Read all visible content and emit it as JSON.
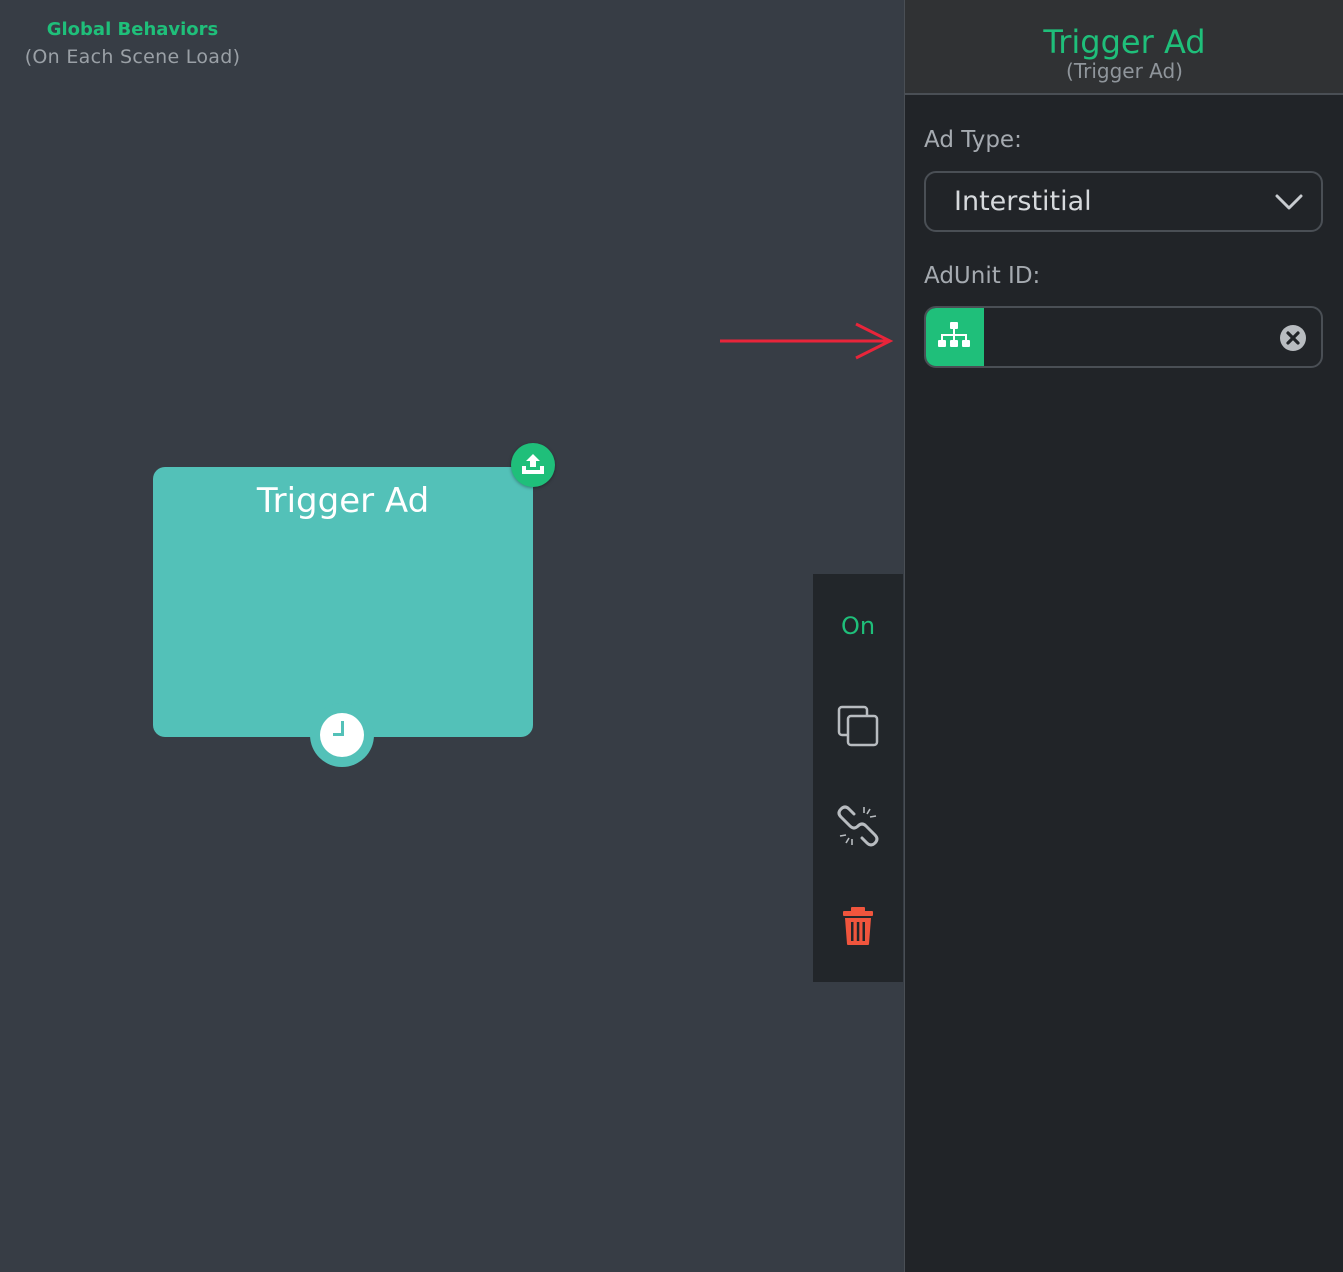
{
  "canvas": {
    "scene_title": "Global Behaviors",
    "scene_subtitle": "(On Each Scene Load)"
  },
  "node": {
    "title": "Trigger Ad",
    "color": "#53c1b8",
    "export_icon": "export-icon",
    "timer_icon": "clock-icon"
  },
  "toolbar": {
    "toggle_label": "On",
    "items": [
      "duplicate-icon",
      "unlink-icon",
      "trash-icon"
    ]
  },
  "panel": {
    "title": "Trigger Ad",
    "subtitle": "(Trigger Ad)",
    "ad_type": {
      "label": "Ad Type:",
      "selected": "Interstitial"
    },
    "ad_unit": {
      "label": "AdUnit ID:",
      "value": "",
      "variable_icon": "sitemap-icon",
      "clear_icon": "clear-icon"
    }
  },
  "colors": {
    "accent": "#1fbf7a",
    "danger": "#f0553d",
    "annotation_arrow": "#e8253a"
  }
}
